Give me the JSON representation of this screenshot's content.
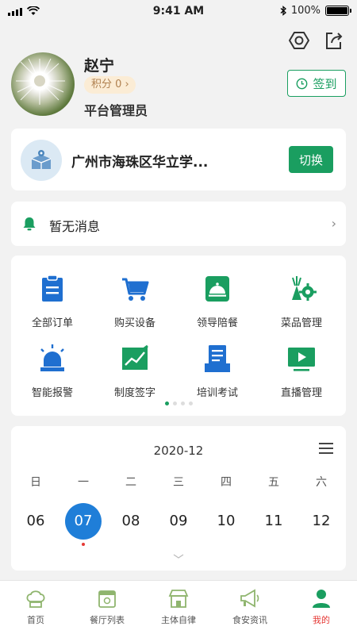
{
  "status_bar": {
    "time": "9:41 AM",
    "battery": "100%"
  },
  "profile": {
    "name": "赵宁",
    "points_label": "积分 0 ›",
    "role": "平台管理员",
    "checkin_label": "签到"
  },
  "school": {
    "name": "广州市海珠区华立学...",
    "switch_label": "切换"
  },
  "message": {
    "text": "暂无消息"
  },
  "menu": {
    "items": [
      {
        "label": "全部订单",
        "icon": "clipboard-icon"
      },
      {
        "label": "购买设备",
        "icon": "cart-icon"
      },
      {
        "label": "领导陪餐",
        "icon": "food-cloche-icon"
      },
      {
        "label": "菜品管理",
        "icon": "vegetable-gear-icon"
      },
      {
        "label": "智能报警",
        "icon": "alarm-light-icon"
      },
      {
        "label": "制度签字",
        "icon": "signature-chart-icon"
      },
      {
        "label": "培训考试",
        "icon": "exam-document-icon"
      },
      {
        "label": "直播管理",
        "icon": "live-video-icon"
      }
    ],
    "page_dots": 4,
    "active_dot": 0
  },
  "calendar": {
    "month": "2020-12",
    "weekdays": [
      "日",
      "一",
      "二",
      "三",
      "四",
      "五",
      "六"
    ],
    "days": [
      "06",
      "07",
      "08",
      "09",
      "10",
      "11",
      "12"
    ],
    "selected_day": "07"
  },
  "tabbar": {
    "tabs": [
      {
        "label": "首页",
        "icon": "chef-hat-icon"
      },
      {
        "label": "餐厅列表",
        "icon": "restaurant-icon"
      },
      {
        "label": "主体自律",
        "icon": "shop-icon"
      },
      {
        "label": "食安资讯",
        "icon": "megaphone-icon"
      },
      {
        "label": "我的",
        "icon": "user-icon"
      }
    ],
    "active": "我的"
  },
  "colors": {
    "accent": "#1a9e60",
    "blue": "#1f7ed8",
    "red": "#e53935"
  }
}
